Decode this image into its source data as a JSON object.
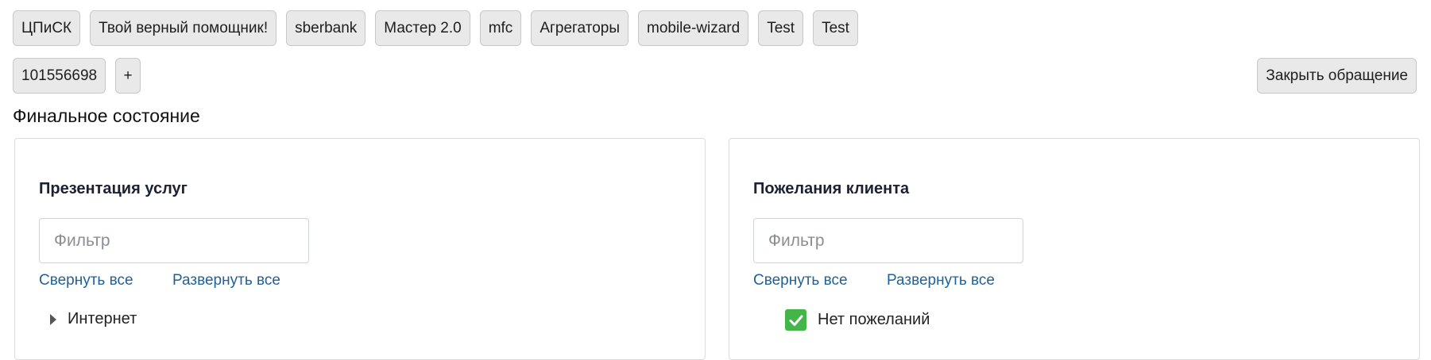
{
  "tabs": [
    {
      "label": "ЦПиСК"
    },
    {
      "label": "Твой верный помощник!"
    },
    {
      "label": "sberbank"
    },
    {
      "label": "Мастер 2.0"
    },
    {
      "label": "mfc"
    },
    {
      "label": "Агрегаторы"
    },
    {
      "label": "mobile-wizard"
    },
    {
      "label": "Test"
    },
    {
      "label": "Test"
    }
  ],
  "tabs_row2": [
    {
      "label": "101556698"
    },
    {
      "label": "+"
    }
  ],
  "close_button_label": "Закрыть обращение",
  "section_title": "Финальное состояние",
  "left_panel": {
    "heading": "Презентация услуг",
    "filter_placeholder": "Фильтр",
    "collapse_all": "Свернуть все",
    "expand_all": "Развернуть все",
    "tree_item_label": "Интернет"
  },
  "right_panel": {
    "heading": "Пожелания клиента",
    "filter_placeholder": "Фильтр",
    "collapse_all": "Свернуть все",
    "expand_all": "Развернуть все",
    "checkbox_label": "Нет пожеланий",
    "checkbox_checked": true
  },
  "colors": {
    "link": "#1f6199",
    "checkbox": "#45b549",
    "chip_bg": "#e9e9ea"
  }
}
